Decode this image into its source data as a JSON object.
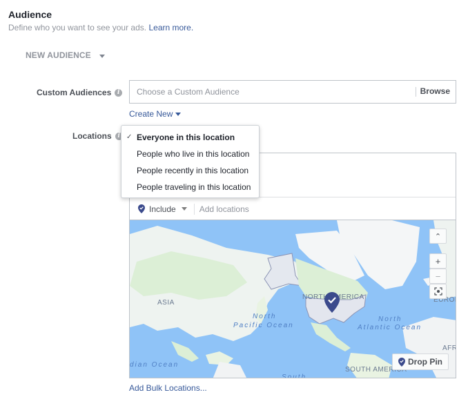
{
  "header": {
    "title": "Audience",
    "subtitle": "Define who you want to see your ads.",
    "learn_more": "Learn more."
  },
  "audience_selector": {
    "label": "NEW AUDIENCE"
  },
  "custom_audiences": {
    "label": "Custom Audiences",
    "placeholder": "Choose a Custom Audience",
    "value": "",
    "browse_label": "Browse",
    "create_new_label": "Create New"
  },
  "locations": {
    "label": "Locations",
    "dropdown": {
      "options": [
        {
          "label": "Everyone in this location",
          "selected": true
        },
        {
          "label": "People who live in this location",
          "selected": false
        },
        {
          "label": "People recently in this location",
          "selected": false
        },
        {
          "label": "People traveling in this location",
          "selected": false
        }
      ]
    },
    "include_label": "Include",
    "add_placeholder": "Add locations",
    "bulk_label": "Add Bulk Locations..."
  },
  "map": {
    "labels": {
      "asia": "ASIA",
      "north_america": "NORTH AMERICA",
      "south_america": "SOUTH AMERICA",
      "europe": "EUROP",
      "africa": "AFR",
      "north_pacific_1": "North",
      "north_pacific_2": "Pacific Ocean",
      "north_atlantic_1": "North",
      "north_atlantic_2": "Atlantic Ocean",
      "indian_ocean": "dian Ocean",
      "south": "South"
    },
    "controls": {
      "collapse": "^",
      "zoom_in": "+",
      "zoom_out": "−"
    },
    "drop_pin_label": "Drop Pin",
    "selected_region": "United States"
  },
  "colors": {
    "link": "#365899",
    "pin": "#3b4a8c",
    "ocean": "#8fc3f7",
    "label_gray": "#4b4f56"
  }
}
